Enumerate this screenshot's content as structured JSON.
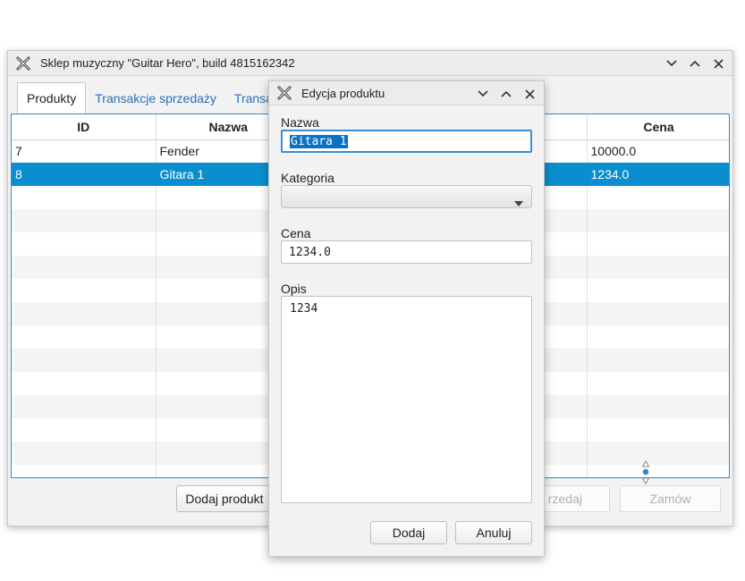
{
  "main_window": {
    "title": "Sklep muzyczny \"Guitar Hero\", build 4815162342",
    "tabs": [
      {
        "label": "Produkty"
      },
      {
        "label": "Transakcje sprzedaży"
      },
      {
        "label": "Transa"
      }
    ],
    "table": {
      "columns": [
        "ID",
        "Nazwa",
        "Cena"
      ],
      "rows": [
        {
          "id": "7",
          "name": "Fender",
          "price": "10000.0"
        },
        {
          "id": "8",
          "name": "Gitara 1",
          "price": "1234.0"
        }
      ],
      "selected_row": 1
    },
    "buttons": {
      "add_product": "Dodaj produkt",
      "sell": "rzedaj",
      "order": "Zamów"
    }
  },
  "dialog": {
    "title": "Edycja produktu",
    "name_label": "Nazwa",
    "name_value": "Gitara 1",
    "category_label": "Kategoria",
    "category_value": "",
    "price_label": "Cena",
    "price_value": "1234.0",
    "description_label": "Opis",
    "description_value": "1234",
    "add_button": "Dodaj",
    "cancel_button": "Anuluj"
  },
  "colors": {
    "selection": "#0a8ecf",
    "accent_border": "#2c8ec9",
    "tab_link": "#2a6fb7"
  },
  "icons": [
    "app-x-icon",
    "minimize-icon",
    "maximize-icon",
    "close-icon",
    "dropdown-arrow-icon",
    "spinner-icon"
  ]
}
